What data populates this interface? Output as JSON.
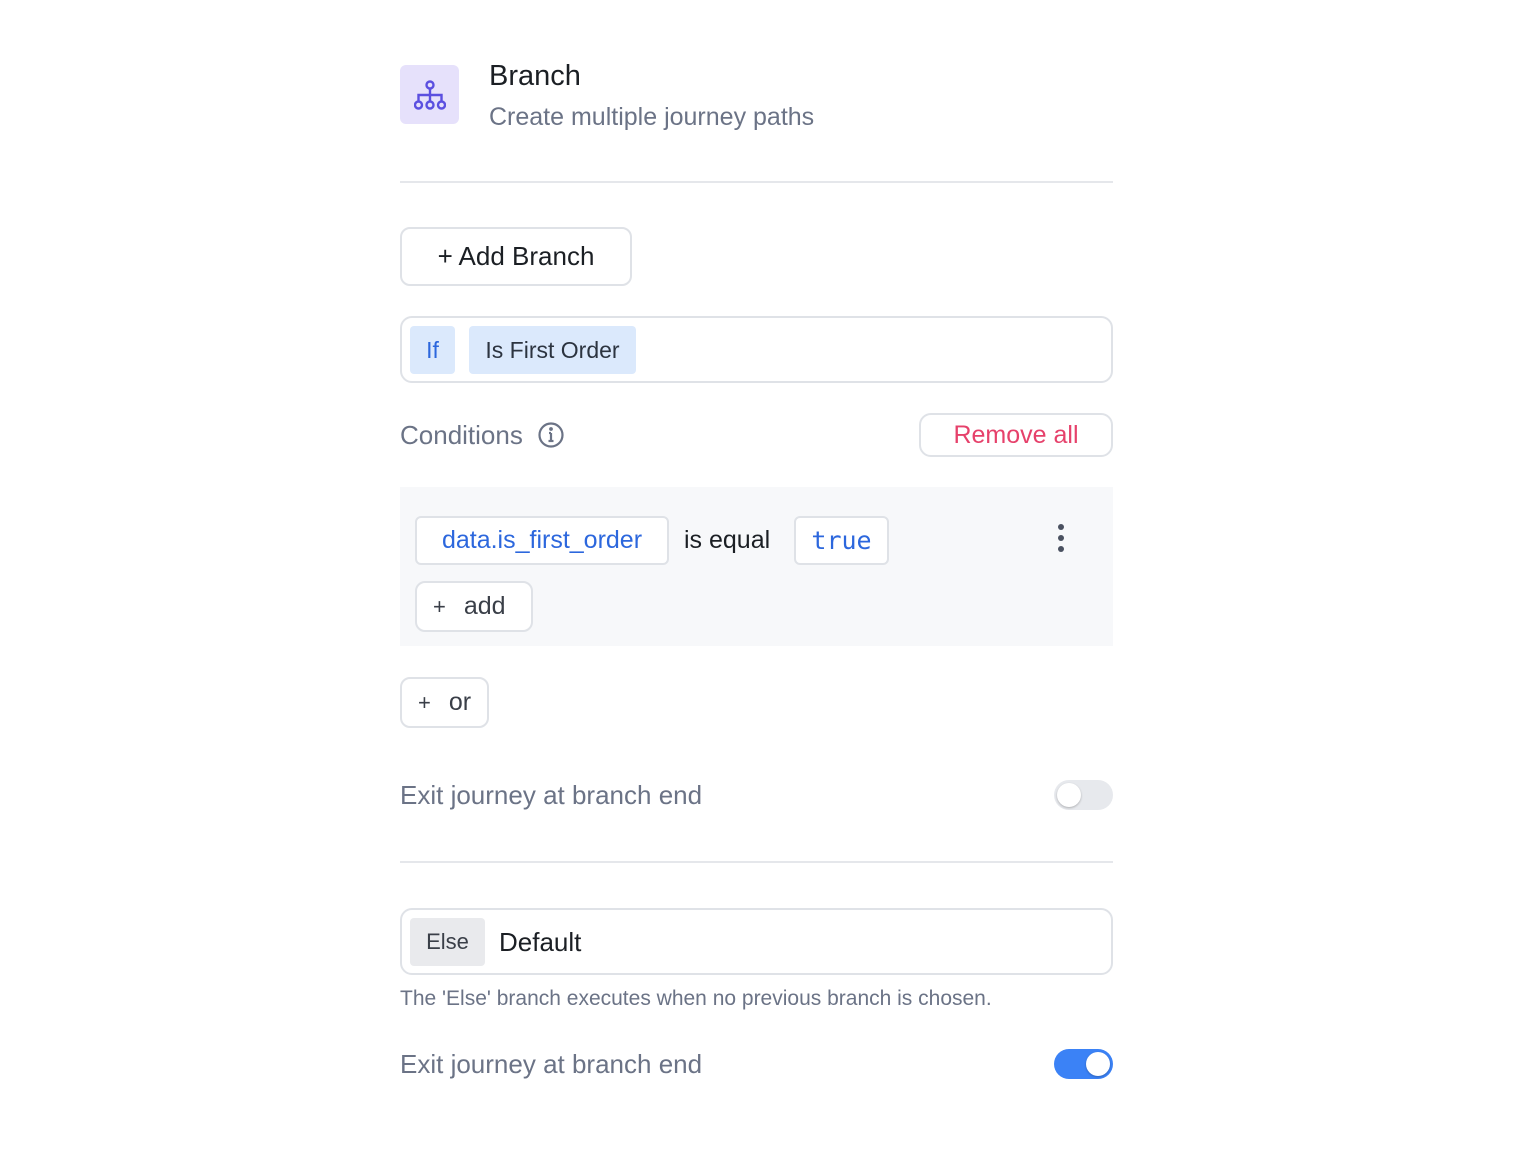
{
  "header": {
    "icon": "branch-hierarchy-icon",
    "title": "Branch",
    "subtitle": "Create multiple journey paths",
    "icon_bg": "#e6e1fb",
    "icon_color": "#5b4fe0"
  },
  "add_branch_label": "+ Add Branch",
  "branch": {
    "type_tag": "If",
    "name": "Is First Order",
    "conditions_label": "Conditions",
    "conditions_info_icon": "info-icon",
    "remove_all_label": "Remove all",
    "condition": {
      "field": "data.is_first_order",
      "operator": "is equal",
      "value": "true",
      "menu_icon": "more-vertical-icon"
    },
    "add_label": "add",
    "or_label": "or",
    "exit_label": "Exit journey at branch end",
    "exit_enabled": false
  },
  "else_branch": {
    "type_tag": "Else",
    "name": "Default",
    "hint": "The 'Else' branch executes when no previous branch is chosen.",
    "exit_label": "Exit journey at branch end",
    "exit_enabled": true
  },
  "colors": {
    "accent_blue": "#2c67dd",
    "danger": "#e6416b",
    "toggle_on": "#3b82f6",
    "muted_text": "#6b7386"
  }
}
